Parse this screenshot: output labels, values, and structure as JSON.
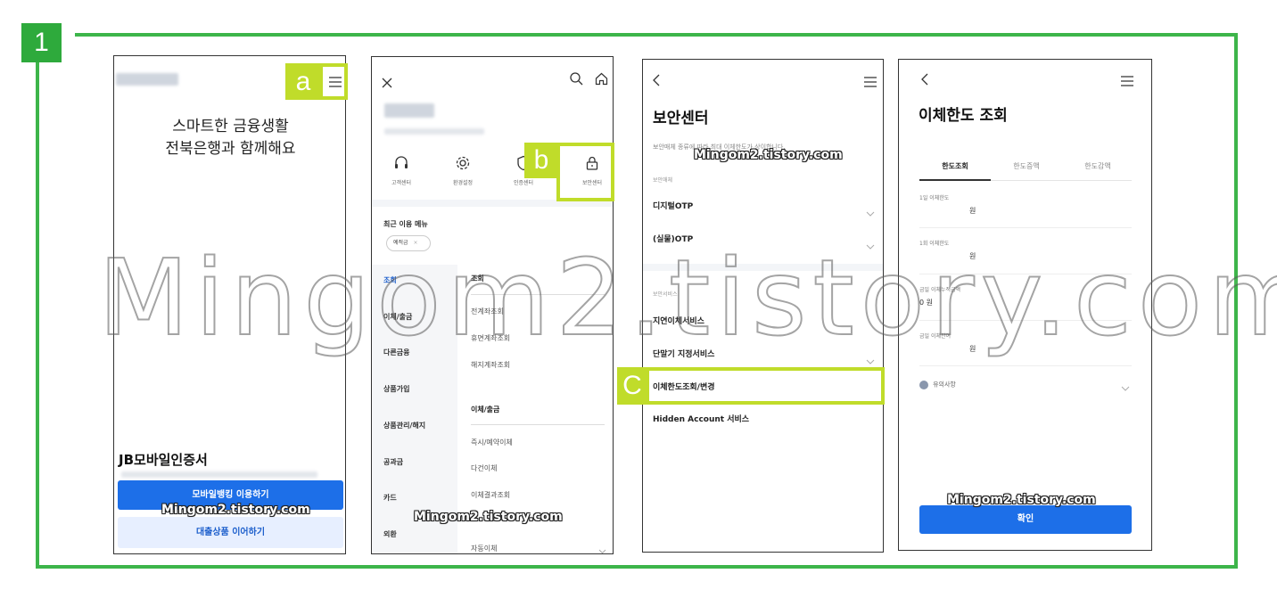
{
  "step_number": "1",
  "callouts": {
    "a": "a",
    "b": "b",
    "c": "C"
  },
  "watermark": {
    "large": "Mingom2.tistory.com",
    "small": "Mingom2.tistory.com"
  },
  "screen1": {
    "hero_line1": "스마트한 금융생활",
    "hero_line2": "전북은행과 함께해요",
    "section_title": "JB모바일인증서",
    "primary_button": "모바일뱅킹 이용하기",
    "secondary_button": "대출상품 이어하기",
    "icons": [
      "menu-icon"
    ]
  },
  "screen2": {
    "quick_menu": [
      "고객센터",
      "환경설정",
      "인증센터",
      "보안센터"
    ],
    "recent_label": "최근 이용 메뉴",
    "recent_chip": "예적금",
    "chip_remove": "×",
    "categories": [
      "조회",
      "이체/출금",
      "다른금융",
      "상품가입",
      "상품관리/해지",
      "공과금",
      "카드",
      "외환"
    ],
    "group1": {
      "title": "조회",
      "items": [
        "전계좌조회",
        "휴면계좌조회",
        "해지계좌조회"
      ]
    },
    "group2": {
      "title": "이체/출금",
      "items": [
        "즉시/예약이체",
        "다건이체",
        "이체결과조회",
        "자동이체"
      ]
    },
    "icons": [
      "close-icon",
      "search-icon",
      "home-icon",
      "headset-icon",
      "gear-icon",
      "shield-icon",
      "lock-icon"
    ]
  },
  "screen3": {
    "title": "보안센터",
    "note": "보안매체 종류에 따라 최대 이체한도가 상이합니다.",
    "media_label": "보안매체",
    "media_items": [
      "디지털OTP",
      "(실물)OTP"
    ],
    "service_label": "보안서비스",
    "services": [
      "지연이체서비스",
      "단말기 지정서비스",
      "이체한도조회/변경",
      "Hidden Account 서비스"
    ]
  },
  "screen4": {
    "title": "이체한도 조회",
    "tabs": [
      "한도조회",
      "한도증액",
      "한도감액"
    ],
    "rows": [
      {
        "label": "1일 이체한도",
        "value": "원"
      },
      {
        "label": "1회 이체한도",
        "value": "원"
      },
      {
        "label": "금일 이체누적금액",
        "value": "0 원"
      },
      {
        "label": "금일 이체잔여",
        "value": "원"
      }
    ],
    "notice": "유의사항",
    "confirm_button": "확인"
  }
}
